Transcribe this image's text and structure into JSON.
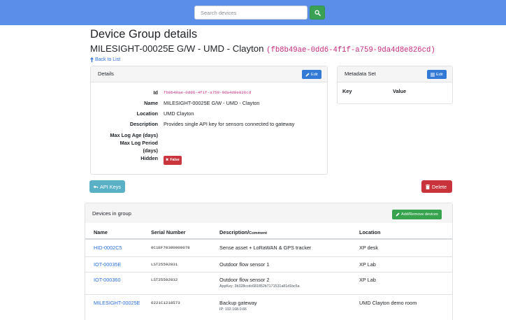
{
  "nav": {
    "search_placeholder": "Search devices"
  },
  "page": {
    "title": "Device Group details",
    "group_name": "MILESIGHT-00025E G/W - UMD - Clayton",
    "group_id_display": "(fb8b49ae-0dd6-4f1f-a759-9da4d8e826cd)",
    "back_link": "Back to List"
  },
  "details": {
    "header": "Details",
    "edit_label": "Edit",
    "fields": [
      {
        "key": "Id",
        "value": "fb8b49ae-0dd6-4f1f-a759-9da4d8e826cd"
      },
      {
        "key": "Name",
        "value": "MILESIGHT-00025E G/W - UMD - Clayton"
      },
      {
        "key": "Location",
        "value": "UMD Clayton"
      },
      {
        "key": "Description",
        "value": "Provides single API key for sensors connected to gateway"
      },
      {
        "key": "Max Log Age (days)",
        "value": ""
      },
      {
        "key_line1": "Max Log Period",
        "key_line2": "(days)",
        "value": ""
      },
      {
        "key": "Hidden",
        "value": "False"
      }
    ]
  },
  "metadata": {
    "header": "Metadata Set",
    "edit_label": "Edit",
    "col_key": "Key",
    "col_value": "Value"
  },
  "actions": {
    "api_keys": "API Keys",
    "delete": "Delete"
  },
  "devices": {
    "header": "Devices in group",
    "add_remove": "Add/Remove devices",
    "columns": {
      "name": "Name",
      "serial": "Serial Number",
      "description": "Description/",
      "description_suffix": "Comment",
      "location": "Location"
    },
    "rows": [
      {
        "name": "HID-0002C5",
        "serial": "0C1EF70300000078",
        "description": "Sense asset + LoRaWAN & GPS tracker",
        "comment": "",
        "location": "XP desk"
      },
      {
        "name": "IOT-00035E",
        "serial": "LST25592831",
        "description": "Outdoor flow sensor 1",
        "comment": "",
        "location": "XP Lab"
      },
      {
        "name": "IOT-000360",
        "serial": "LST25592832",
        "description": "Outdoor flow sensor 2",
        "comment": "AppKey: 3b328ccdc681852b7171531a81d1bc5a",
        "location": "XP Lab"
      },
      {
        "name": "MILESIGHT-00025E",
        "serial": "6221C1218573",
        "description": "Backup gateway",
        "comment": "IP: 192.168.0.66",
        "location": "UMD Clayton demo room"
      }
    ]
  },
  "colors": {
    "navbar": "#5a8ee8",
    "primary": "#3379d6",
    "success": "#38a34f",
    "info": "#5ab1c6",
    "danger": "#c9343c",
    "code_pink": "#c7297e",
    "link": "#2a6fdb"
  }
}
